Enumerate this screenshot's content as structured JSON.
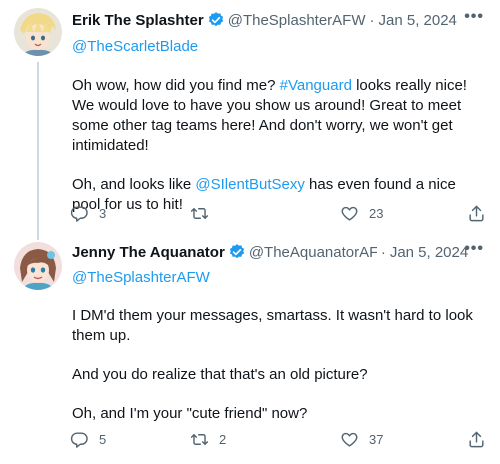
{
  "tweets": [
    {
      "display_name": "Erik The Splashter",
      "handle": "@TheSplashterAFW",
      "separator": "·",
      "date": "Jan 5, 2024",
      "replying_to": "@TheScarletBlade",
      "paragraphs": [
        {
          "pre": "Oh wow, how did you find me? ",
          "link": "#Vanguard",
          "post": " looks really nice! We would love to have you show us around! Great to meet some other tag teams here! And don't worry, we won't get intimidated!"
        },
        {
          "pre": "Oh, and looks like ",
          "link": "@SIlentButSexy",
          "post": " has even found a nice pool for us to hit!"
        }
      ],
      "more_label": "•••",
      "actions": {
        "replies": "3",
        "retweets": "",
        "likes": "23"
      }
    },
    {
      "display_name": "Jenny The Aquanator",
      "handle": "@TheAquanatorAF'",
      "separator": "·",
      "date": "Jan 5, 2024",
      "replying_to": "@TheSplashterAFW",
      "paragraphs": [
        "I DM'd them your messages, smartass. It wasn't hard to look them up.",
        "And you do realize that that's an old picture?",
        "Oh, and I'm your \"cute friend\" now?"
      ],
      "more_label": "•••",
      "actions": {
        "replies": "5",
        "retweets": "2",
        "likes": "37"
      }
    }
  ],
  "icons": {
    "verified": "verified-badge-icon",
    "reply": "reply-icon",
    "retweet": "retweet-icon",
    "like": "heart-icon",
    "share": "share-icon"
  },
  "colors": {
    "link": "#1d9bf0",
    "secondary_text": "#536471",
    "thread_line": "#cfd9de"
  }
}
